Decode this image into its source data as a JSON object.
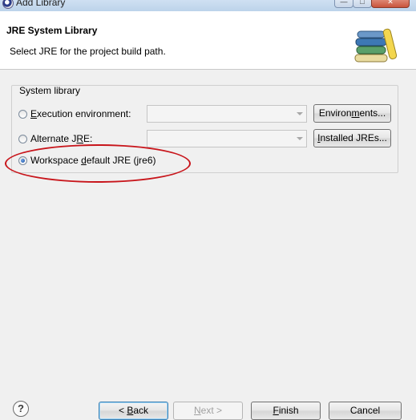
{
  "window": {
    "title": "Add Library"
  },
  "banner": {
    "title": "JRE System Library",
    "description": "Select JRE for the project build path."
  },
  "group": {
    "label": "System library",
    "options": [
      {
        "pre": "",
        "mnemonic": "E",
        "post": "xecution environment:",
        "selected": false
      },
      {
        "pre": "Alternate J",
        "mnemonic": "R",
        "post": "E:",
        "selected": false
      },
      {
        "pre": "Workspace ",
        "mnemonic": "d",
        "post": "efault JRE (jre6)",
        "selected": true
      }
    ],
    "environments_button": {
      "pre": "Environ",
      "mnemonic": "m",
      "post": "ents..."
    },
    "installed_jres_button": {
      "pre": "",
      "mnemonic": "I",
      "post": "nstalled JREs..."
    },
    "execution_env_value": "",
    "alternate_jre_value": ""
  },
  "buttons": {
    "back": {
      "pre": "< ",
      "mnemonic": "B",
      "post": "ack"
    },
    "next": {
      "pre": "",
      "mnemonic": "N",
      "post": "ext >"
    },
    "finish": {
      "pre": "",
      "mnemonic": "F",
      "post": "inish"
    },
    "cancel": "Cancel"
  },
  "help_glyph": "?",
  "colors": {
    "annotation_circle": "#c8151b",
    "banner_background": "#ffffff",
    "dialog_background": "#f0f0f0"
  }
}
